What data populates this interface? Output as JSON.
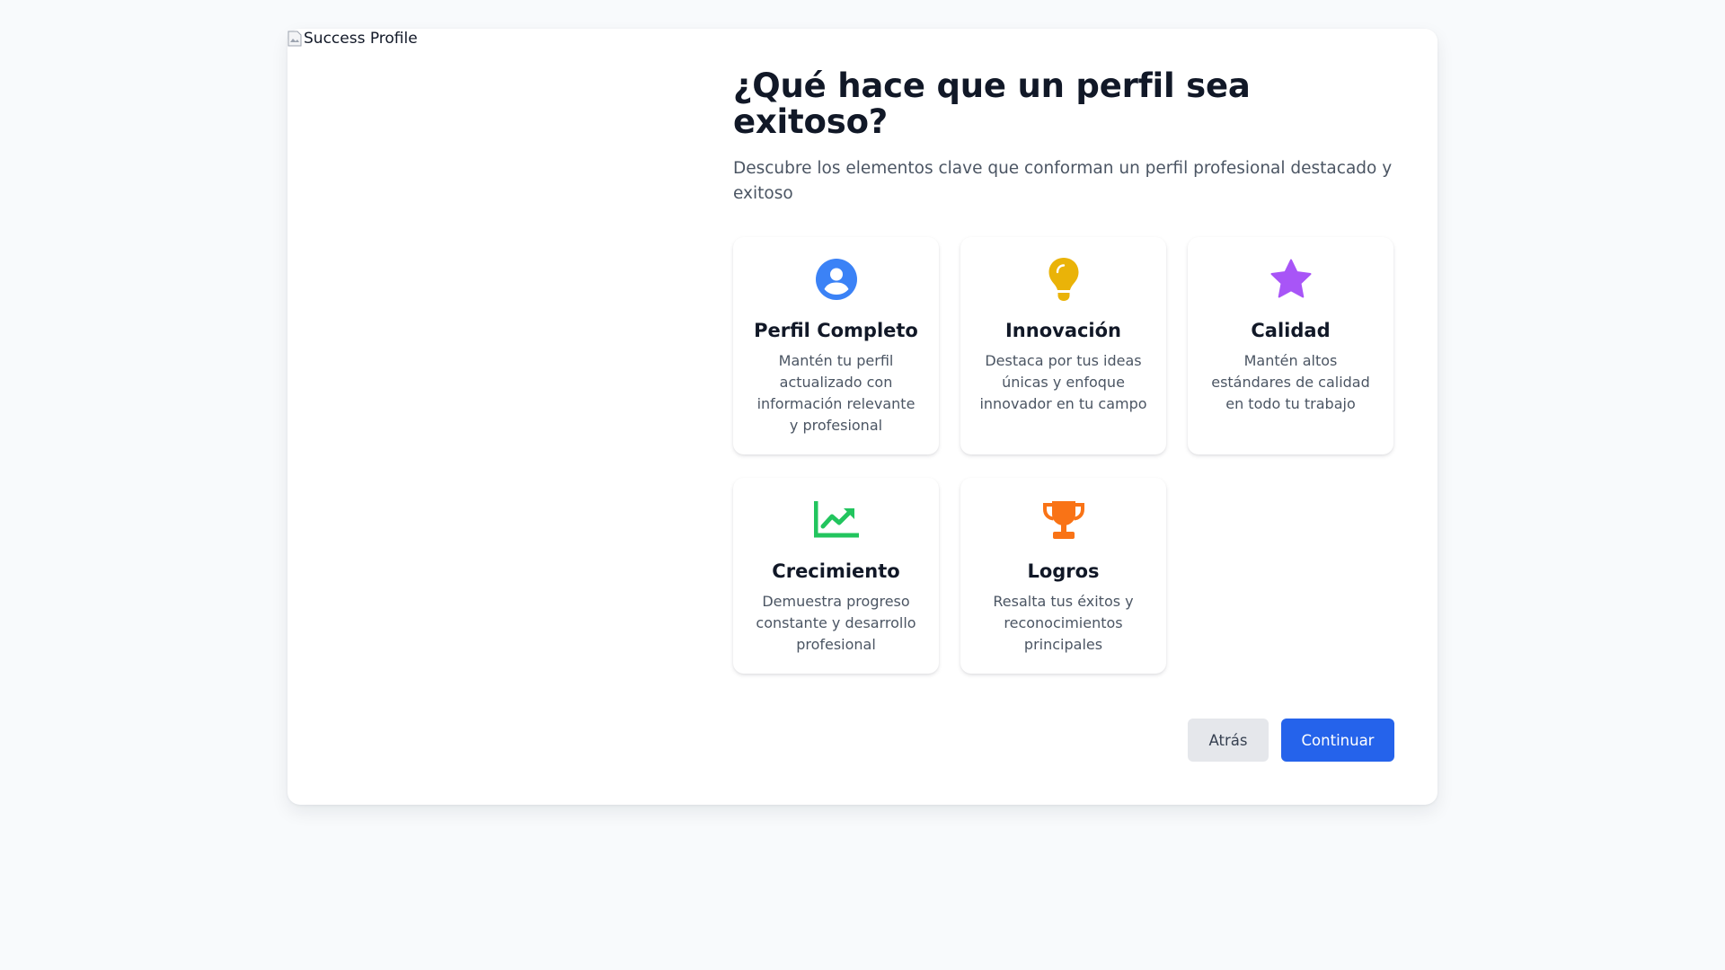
{
  "image": {
    "alt": "Success Profile",
    "icon": "broken-image-icon"
  },
  "header": {
    "title": "¿Qué hace que un perfil sea exitoso?",
    "subtitle": "Descubre los elementos clave que conforman un perfil profesional destacado y exitoso"
  },
  "cards": [
    {
      "icon": "user-circle-icon",
      "color": "#3b82f6",
      "title": "Perfil Completo",
      "description": "Mantén tu perfil actualizado con información relevante y profesional"
    },
    {
      "icon": "lightbulb-icon",
      "color": "#eab308",
      "title": "Innovación",
      "description": "Destaca por tus ideas únicas y enfoque innovador en tu campo"
    },
    {
      "icon": "star-icon",
      "color": "#a855f7",
      "title": "Calidad",
      "description": "Mantén altos estándares de calidad en todo tu trabajo"
    },
    {
      "icon": "chart-line-icon",
      "color": "#22c55e",
      "title": "Crecimiento",
      "description": "Demuestra progreso constante y desarrollo profesional"
    },
    {
      "icon": "trophy-icon",
      "color": "#f97316",
      "title": "Logros",
      "description": "Resalta tus éxitos y reconocimientos principales"
    }
  ],
  "actions": {
    "back_label": "Atrás",
    "continue_label": "Continuar",
    "continue_color": "#2563eb",
    "back_color": "#e5e7eb"
  }
}
